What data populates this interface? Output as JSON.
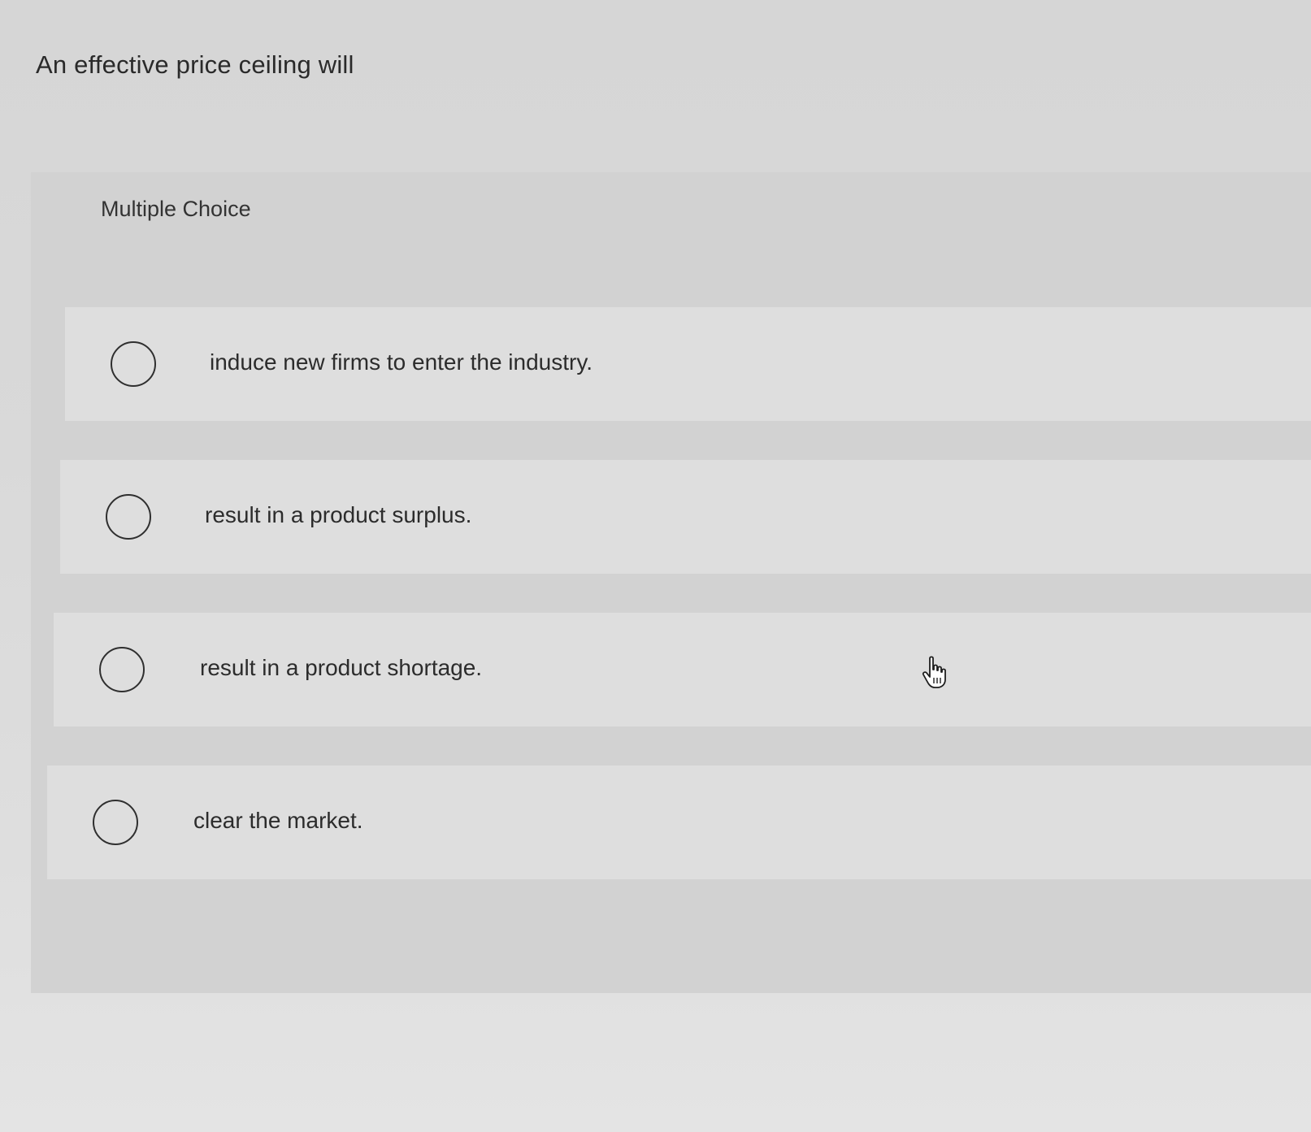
{
  "question": {
    "text": "An effective price ceiling will"
  },
  "answer_panel": {
    "type_label": "Multiple Choice",
    "options": [
      {
        "label": "induce new firms to enter the industry.",
        "selected": false
      },
      {
        "label": "result in a product surplus.",
        "selected": false
      },
      {
        "label": "result in a product shortage.",
        "selected": false
      },
      {
        "label": "clear the market.",
        "selected": false
      }
    ]
  },
  "cursor": {
    "icon": "hand-pointer-icon"
  },
  "colors": {
    "background": "#dcdcdc",
    "panel": "#d2d2d2",
    "option_row": "#dedede",
    "text": "#2b2b2b",
    "radio_border": "#2f2f2f"
  }
}
